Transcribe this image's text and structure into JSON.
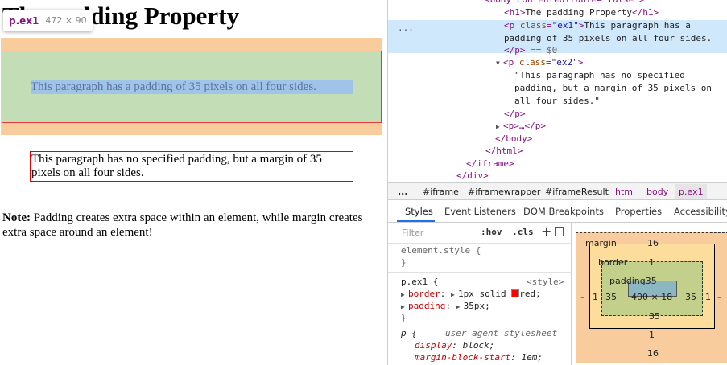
{
  "page": {
    "h1": "The padding Property",
    "ex1_text": "This paragraph has a padding of 35 pixels on all four sides.",
    "ex2_text": "This paragraph has no specified padding, but a margin of 35 pixels on all four sides.",
    "note_label": "Note:",
    "note_text": " Padding creates extra space within an element, while margin creates extra space around an element!"
  },
  "tooltip": {
    "selector": "p.ex1",
    "size": "472 × 90"
  },
  "dom": {
    "top_partial": "<body contenteditable=\"false\">",
    "l_h1_open": "<h1>",
    "l_h1_text": "The padding Property",
    "l_h1_close": "</h1>",
    "l_p_open": "<p ",
    "l_class": "class",
    "l_eq": "=",
    "l_ex1": "\"ex1\"",
    "l_gt": ">",
    "l_ex1_text_a": "This paragraph has a",
    "l_ex1_text_b": "padding of 35 pixels on all four sides.",
    "l_p_close": "</p>",
    "l_eq0": " == $0",
    "l_ex2": "\"ex2\"",
    "l_ex2_a": "\"This paragraph has no specified",
    "l_ex2_b": "padding, but a margin of 35 pixels on",
    "l_ex2_c": "all four sides.\"",
    "l_p_collapsed": "<p>…</p>",
    "l_body_close": "</body>",
    "l_html_close": "</html>",
    "l_iframe_close": "</iframe>",
    "l_div_close": "</div>",
    "ellipsis": "..."
  },
  "breadcrumbs": [
    "...",
    "#iframe",
    "#iframewrapper",
    "#iframeResult",
    "html",
    "body",
    "p.ex1"
  ],
  "tabs": [
    "Styles",
    "Event Listeners",
    "DOM Breakpoints",
    "Properties",
    "Accessibility"
  ],
  "styles": {
    "filter_placeholder": "Filter",
    "hov": ":hov",
    "cls": ".cls",
    "plus": "+",
    "element_style": "element.style {",
    "close_brace": "}",
    "rule1_selector": "p.ex1 {",
    "rule1_source": "<style>",
    "rule1_p1_name": "border",
    "rule1_p1_value": "1px solid",
    "rule1_p1_color": "red;",
    "rule1_p2_name": "padding",
    "rule1_p2_value": "35px;",
    "rule2_selector": "p {",
    "rule2_source": "user agent stylesheet",
    "rule2_p1_name": "display",
    "rule2_p1_value": "block;",
    "rule2_p2_name": "margin-block-start",
    "rule2_p2_value": "1em;",
    "colon": ":",
    "swatch_color": "#ff0000"
  },
  "box_model": {
    "margin_label": "margin",
    "margin_top": "16",
    "margin_bottom": "16",
    "margin_left": "–",
    "margin_right": "–",
    "border_label": "border",
    "border_top": "1",
    "border_bottom": "1",
    "border_left": "1",
    "border_right": "1",
    "padding_label": "padding35",
    "padding_bottom": "35",
    "padding_left": "35",
    "padding_right": "35",
    "content": "400 × 18"
  }
}
